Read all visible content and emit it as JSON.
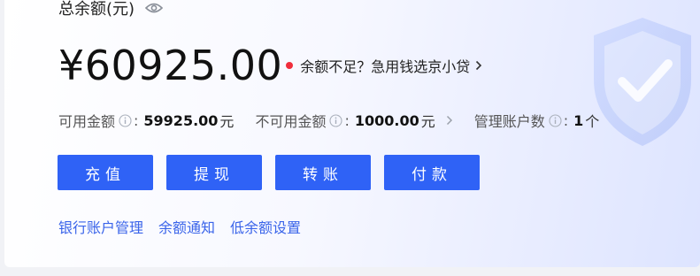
{
  "balance": {
    "title": "总余额(元)",
    "amount": "¥60925.00",
    "promo_text": "余额不足？急用钱选京小贷"
  },
  "stats": [
    {
      "label": "可用金额",
      "value": "59925.00",
      "unit": "元"
    },
    {
      "label": "不可用金额",
      "value": "1000.00",
      "unit": "元"
    },
    {
      "label": "管理账户数",
      "value": "1",
      "unit": "个"
    }
  ],
  "actions": [
    "充值",
    "提现",
    "转账",
    "付款"
  ],
  "links": [
    "银行账户管理",
    "余额通知",
    "低余额设置"
  ],
  "colors": {
    "primary": "#2f62f6",
    "link": "#3a64ea",
    "alert_dot": "#f02e3c"
  },
  "icons": [
    "eye-icon",
    "info-icon",
    "chevron-right-icon",
    "shield-decoration"
  ]
}
